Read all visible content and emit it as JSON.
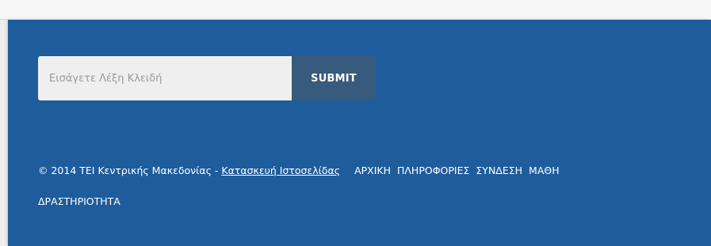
{
  "search": {
    "placeholder": "Εισάγετε Λέξη Κλειδή",
    "value": "",
    "submit_label": "SUBMIT"
  },
  "footer": {
    "copyright": "© 2014 ΤΕΙ Κεντρικής Μακεδονίας - ",
    "builder_link": "Κατασκευή Ιστοσελίδας",
    "nav": [
      {
        "label": "ΑΡΧΙΚΗ"
      },
      {
        "label": "ΠΛΗΡΟΦΟΡΙΕΣ"
      },
      {
        "label": "ΣΥΝΔΕΣΗ"
      },
      {
        "label": "ΜΑΘΗ"
      }
    ],
    "nav_second_line": "ΔΡΑΣΤΗΡΙΟΤΗΤΑ"
  },
  "colors": {
    "footer_background": "#1e5c9c",
    "submit_background": "#385a7c",
    "input_background": "#efefef"
  }
}
